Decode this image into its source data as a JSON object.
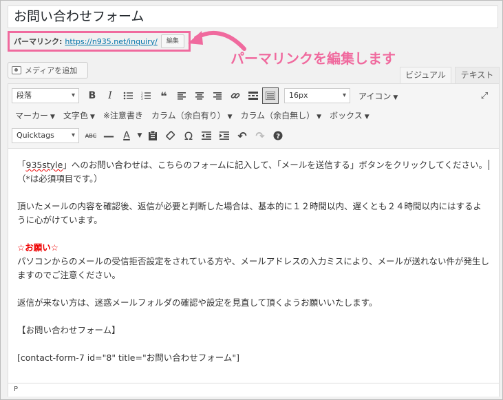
{
  "post": {
    "title": "お問い合わせフォーム"
  },
  "permalink": {
    "label": "パーマリンク:",
    "url": "https://n935.net/inquiry/",
    "edit_button": "編集"
  },
  "annotation": {
    "text": "パーマリンクを編集します",
    "color": "#f06a9e"
  },
  "media_button": {
    "label": "メディアを追加"
  },
  "tabs": {
    "visual": "ビジュアル",
    "text": "テキスト"
  },
  "toolbar": {
    "format_select": "段落",
    "font_size_select": "16px",
    "icon_menu": "アイコン",
    "marker_menu": "マーカー",
    "text_color_menu": "文字色",
    "note_button": "※注意書き",
    "column_margin_menu": "カラム（余白有り）",
    "column_nomargin_menu": "カラム（余白無し）",
    "box_menu": "ボックス",
    "quicktags_select": "Quicktags"
  },
  "content": {
    "p1a": "「",
    "p1_brand": "935style",
    "p1b": "」へのお問い合わせは、こちらのフォームに記入して、「メールを送信する」ボタンをクリックしてください。",
    "p1c": "（*は必須項目です。）",
    "p2": "頂いたメールの内容を確認後、返信が必要と判断した場合は、基本的に１２時間以内、遅くとも２４時間以内にはするように心がけています。",
    "p3_heading": "☆お願い☆",
    "p3": "パソコンからのメールの受信拒否設定をされている方や、メールアドレスの入力ミスにより、メールが送れない件が発生しますのでご注意ください。",
    "p4": "返信が来ない方は、迷惑メールフォルダの確認や設定を見直して頂くようお願いいたします。",
    "p5": "【お問い合わせフォーム】",
    "p6": "[contact-form-7 id=\"8\" title=\"お問い合わせフォーム\"]"
  },
  "statusbar": {
    "path": "P"
  }
}
